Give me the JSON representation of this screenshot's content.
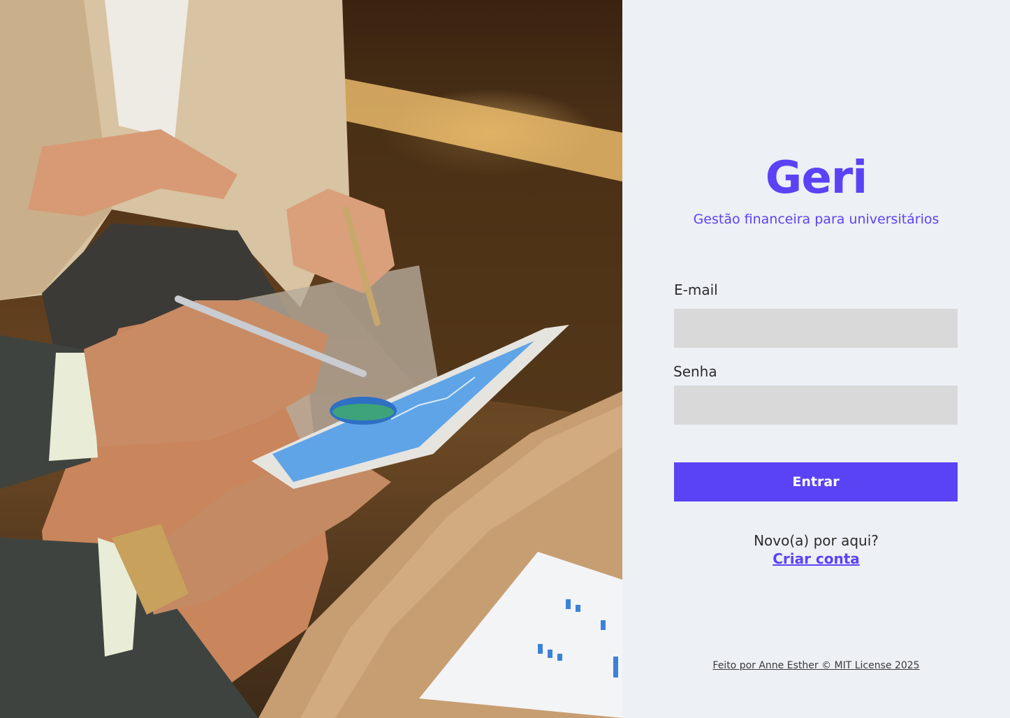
{
  "hero": {
    "image": "business-meeting-tablet-photo"
  },
  "brand": {
    "name": "Geri",
    "tagline": "Gestão financeira para universitários",
    "accent": "#5a43f5"
  },
  "form": {
    "email_label": "E-mail",
    "email_value": "",
    "password_label": "Senha",
    "password_value": "",
    "submit_label": "Entrar"
  },
  "signup": {
    "prompt": "Novo(a) por aqui?",
    "link_label": "Criar conta"
  },
  "footer": {
    "text": "Feito por Anne Esther © MIT License 2025"
  },
  "colors": {
    "panel_bg": "#edf0f4",
    "field_bg": "#d9d9d9",
    "button_bg": "#5a43f5"
  }
}
